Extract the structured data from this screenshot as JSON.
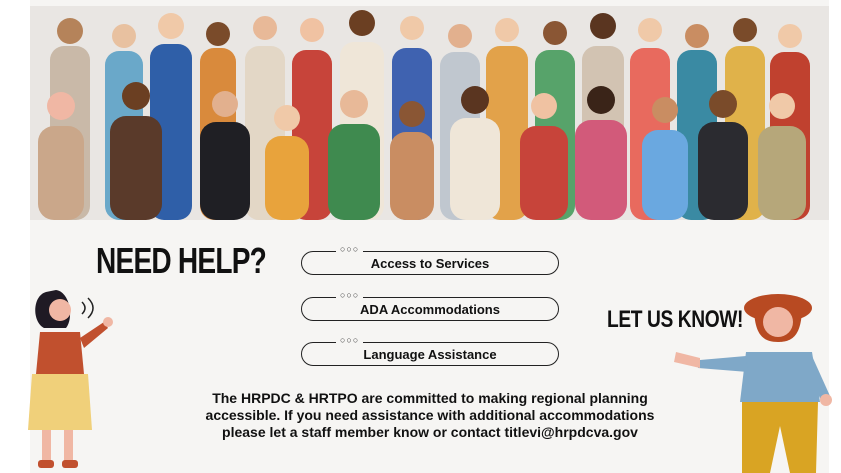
{
  "heading": "NEED HELP?",
  "call_to_action": "LET US KNOW!",
  "options": [
    {
      "dots": "○○○",
      "label": "Access to Services"
    },
    {
      "dots": "○○○",
      "label": "ADA Accommodations"
    },
    {
      "dots": "○○○",
      "label": "Language Assistance"
    }
  ],
  "statement": {
    "line1": "The HRPDC & HRTPO are committed to making regional planning",
    "line2": "accessible. If you need assistance with additional accommodations",
    "line3": "please let a staff member know or contact titlevi@hrpdcva.gov"
  },
  "colors": {
    "background": "#f6f5f3",
    "text": "#111111",
    "banner_background": "#e9e6e3"
  }
}
